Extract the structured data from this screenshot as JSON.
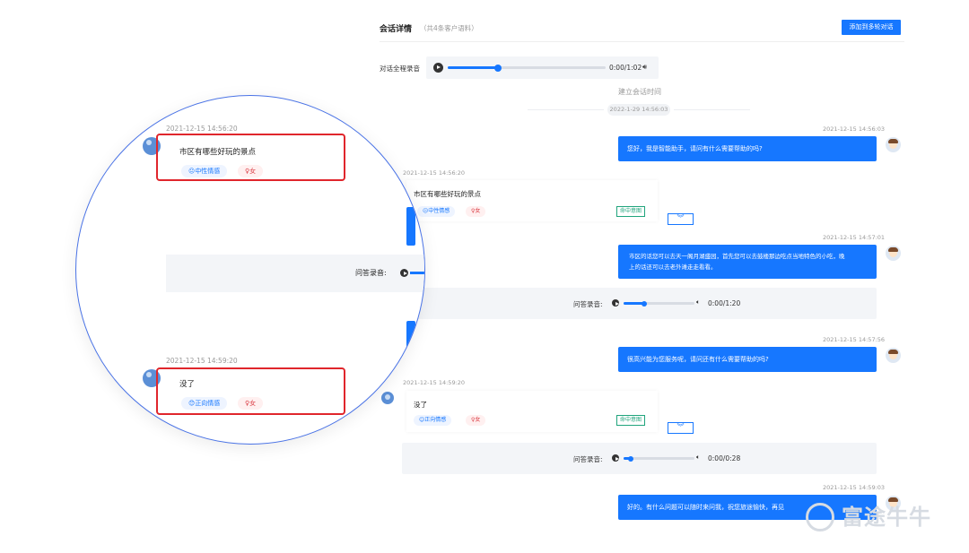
{
  "header": {
    "title": "会话详情",
    "subtitle": "（共4条客户语料）",
    "add_button": "添加到多轮对话"
  },
  "recording": {
    "label": "对话全程录音",
    "time": "0:00/1:02",
    "progress": 0.32
  },
  "session": {
    "established_label": "建立会话时间",
    "established_time": "2022-1-29  14:56:03"
  },
  "messages": [
    {
      "role": "bot",
      "time": "2021-12-15  14:56:03",
      "text": "您好，我是智能助手，请问有什么需要帮助的吗?"
    },
    {
      "role": "user",
      "time": "2021-12-15  14:56:20",
      "text": "市区有哪些好玩的景点",
      "sentiment": "中性情感",
      "gender": "女",
      "intent": "命中意图"
    },
    {
      "role": "bot",
      "time": "2021-12-15  14:57:01",
      "text": "市区的话您可以去天一阁月湖盛园，晚上的话还可以去老外滩走走看看。",
      "line1": "市区的话您可以去天一阁月湖盛园，首先您可以去鼓楼那边吃点当地特色的小吃，晚",
      "line2": "上的话还可以去老外滩走走看看。"
    },
    {
      "role": "answer",
      "label": "问答录音:",
      "time": "0:00/1:20",
      "progress": 0.3
    },
    {
      "role": "bot",
      "time": "2021-12-15  14:57:56",
      "text": "很高兴能为您服务呢，请问还有什么需要帮助的吗?"
    },
    {
      "role": "user",
      "time": "2021-12-15  14:59:20",
      "text": "没了",
      "sentiment": "正向情感",
      "gender": "女",
      "intent": "命中意图"
    },
    {
      "role": "answer",
      "label": "问答录音:",
      "time": "0:00/0:28",
      "progress": 0.12
    },
    {
      "role": "bot",
      "time": "2021-12-15  14:59:03",
      "text": "好的。有什么问题可以随时来问我，祝您旅途愉快，再见"
    }
  ],
  "zoom": {
    "msg1_time": "2021-12-15  14:56:20",
    "msg1_text": "市区有哪些好玩的景点",
    "msg1_sentiment": "中性情感",
    "msg1_gender": "女",
    "answer_label": "问答录音:",
    "msg2_time": "2021-12-15  14:59:20",
    "msg2_text": "没了",
    "msg2_sentiment": "正向情感",
    "msg2_gender": "女"
  },
  "watermark": "富途牛牛",
  "colors": {
    "primary": "#1677ff",
    "highlight": "#e0262c",
    "intent": "#20a47c"
  }
}
